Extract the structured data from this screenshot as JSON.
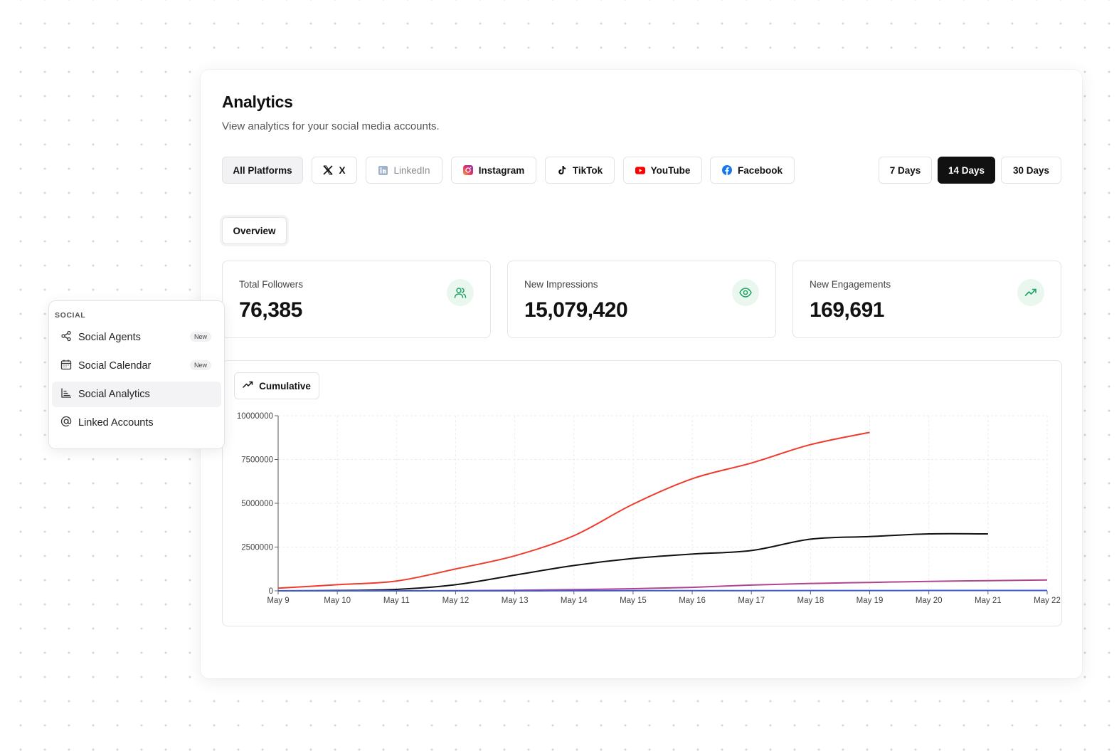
{
  "header": {
    "title": "Analytics",
    "subtitle": "View analytics for your social media accounts."
  },
  "platforms": [
    {
      "label": "All Platforms",
      "icon": "none"
    },
    {
      "label": "X",
      "icon": "x-logo-icon"
    },
    {
      "label": "LinkedIn",
      "icon": "linkedin-icon"
    },
    {
      "label": "Instagram",
      "icon": "instagram-icon"
    },
    {
      "label": "TikTok",
      "icon": "tiktok-icon"
    },
    {
      "label": "YouTube",
      "icon": "youtube-icon"
    },
    {
      "label": "Facebook",
      "icon": "facebook-icon"
    }
  ],
  "ranges": [
    {
      "label": "7 Days",
      "selected": false
    },
    {
      "label": "14 Days",
      "selected": true
    },
    {
      "label": "30 Days",
      "selected": false
    }
  ],
  "tabs": {
    "overview": "Overview"
  },
  "stats": [
    {
      "label": "Total Followers",
      "value": "76,385",
      "icon": "users-icon"
    },
    {
      "label": "New Impressions",
      "value": "15,079,420",
      "icon": "eye-icon"
    },
    {
      "label": "New Engagements",
      "value": "169,691",
      "icon": "trending-up-icon"
    }
  ],
  "chart_toggle": {
    "label": "Cumulative"
  },
  "sidebar": {
    "section": "SOCIAL",
    "items": [
      {
        "label": "Social Agents",
        "badge": "New",
        "icon": "share-icon"
      },
      {
        "label": "Social Calendar",
        "badge": "New",
        "icon": "calendar-icon"
      },
      {
        "label": "Social Analytics",
        "badge": "",
        "icon": "bar-chart-icon",
        "active": true
      },
      {
        "label": "Linked Accounts",
        "badge": "",
        "icon": "at-sign-icon"
      }
    ]
  },
  "colors": {
    "accent_green": "#1fa463",
    "red_series": "#ef3b2d",
    "black_series": "#111111",
    "purple_series": "#b0458f",
    "blue_series": "#3b5bdb"
  },
  "chart_data": {
    "type": "line",
    "x": [
      "May 9",
      "May 10",
      "May 11",
      "May 12",
      "May 13",
      "May 14",
      "May 15",
      "May 16",
      "May 17",
      "May 18",
      "May 19",
      "May 20",
      "May 21",
      "May 22"
    ],
    "y_ticks": [
      "0",
      "2500000",
      "5000000",
      "7500000",
      "10000000"
    ],
    "ylim": [
      0,
      10000000
    ],
    "grid": true,
    "series": [
      {
        "color": "#ef3b2d",
        "values": [
          150000,
          350000,
          560000,
          1250000,
          2000000,
          3150000,
          4950000,
          6400000,
          7300000,
          8350000,
          9050000,
          null,
          null,
          null
        ]
      },
      {
        "color": "#111111",
        "values": [
          0,
          20000,
          80000,
          350000,
          900000,
          1450000,
          1850000,
          2100000,
          2300000,
          2950000,
          3100000,
          3250000,
          3250000,
          null
        ]
      },
      {
        "color": "#b0458f",
        "values": [
          0,
          0,
          0,
          10000,
          30000,
          70000,
          120000,
          200000,
          330000,
          420000,
          480000,
          540000,
          580000,
          620000
        ]
      },
      {
        "color": "#3b5bdb",
        "values": [
          0,
          0,
          0,
          0,
          0,
          5000,
          8000,
          10000,
          12000,
          14000,
          16000,
          18000,
          20000,
          22000
        ]
      }
    ]
  }
}
